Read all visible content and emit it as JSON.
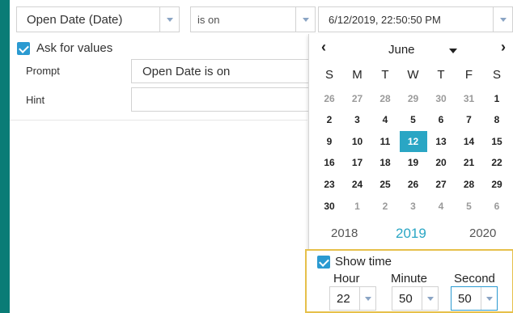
{
  "filter": {
    "field": "Open Date (Date)",
    "operator": "is on",
    "date_value": "6/12/2019, 22:50:50 PM"
  },
  "ask": {
    "label": "Ask for values",
    "checked": true,
    "prompt_label": "Prompt",
    "prompt_value": "Open Date is on",
    "hint_label": "Hint",
    "hint_value": ""
  },
  "calendar": {
    "prev_icon": "chevron-left-icon",
    "next_icon": "chevron-right-icon",
    "month": "June",
    "weekdays": [
      "S",
      "M",
      "T",
      "W",
      "T",
      "F",
      "S"
    ],
    "weeks": [
      [
        "26",
        "27",
        "28",
        "29",
        "30",
        "31",
        "1"
      ],
      [
        "2",
        "3",
        "4",
        "5",
        "6",
        "7",
        "8"
      ],
      [
        "9",
        "10",
        "11",
        "12",
        "13",
        "14",
        "15"
      ],
      [
        "16",
        "17",
        "18",
        "19",
        "20",
        "21",
        "22"
      ],
      [
        "23",
        "24",
        "25",
        "26",
        "27",
        "28",
        "29"
      ],
      [
        "30",
        "1",
        "2",
        "3",
        "4",
        "5",
        "6"
      ]
    ],
    "selected_day": "12",
    "accent_color": "#2aa6c4",
    "years": [
      "2018",
      "2019",
      "2020"
    ],
    "current_year": "2019"
  },
  "time": {
    "show_label": "Show time",
    "checked": true,
    "hour_label": "Hour",
    "minute_label": "Minute",
    "second_label": "Second",
    "hour": "22",
    "minute": "50",
    "second": "50"
  }
}
